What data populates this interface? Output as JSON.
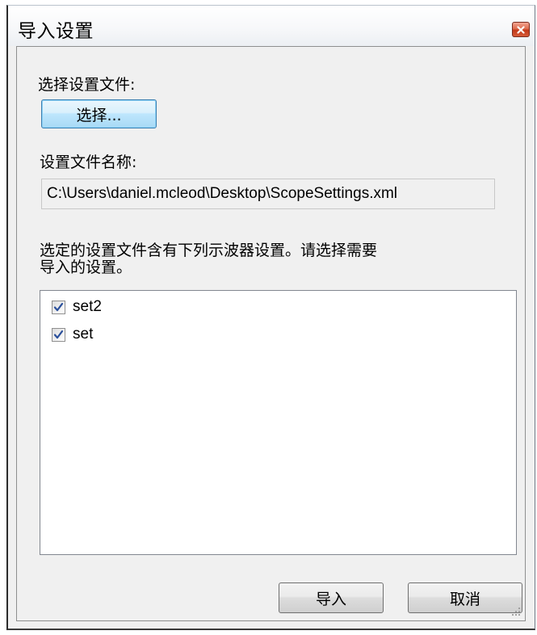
{
  "window": {
    "title": "导入设置",
    "close_icon": "close-icon"
  },
  "select_section": {
    "label": "选择设置文件:",
    "button_label": "选择..."
  },
  "filename_section": {
    "label": "设置文件名称:",
    "value": "C:\\Users\\daniel.mcleod\\Desktop\\ScopeSettings.xml"
  },
  "settings_section": {
    "description_line1": "选定的设置文件含有下列示波器设置。请选择需要",
    "description_line2": "导入的设置。",
    "items": [
      {
        "label": "set2",
        "checked": true
      },
      {
        "label": "set",
        "checked": true
      }
    ]
  },
  "footer": {
    "import_label": "导入",
    "cancel_label": "取消"
  },
  "colors": {
    "close_button": "#d04a28",
    "check_mark": "#2a4f9b",
    "dialog_background": "#f0f0f0"
  }
}
